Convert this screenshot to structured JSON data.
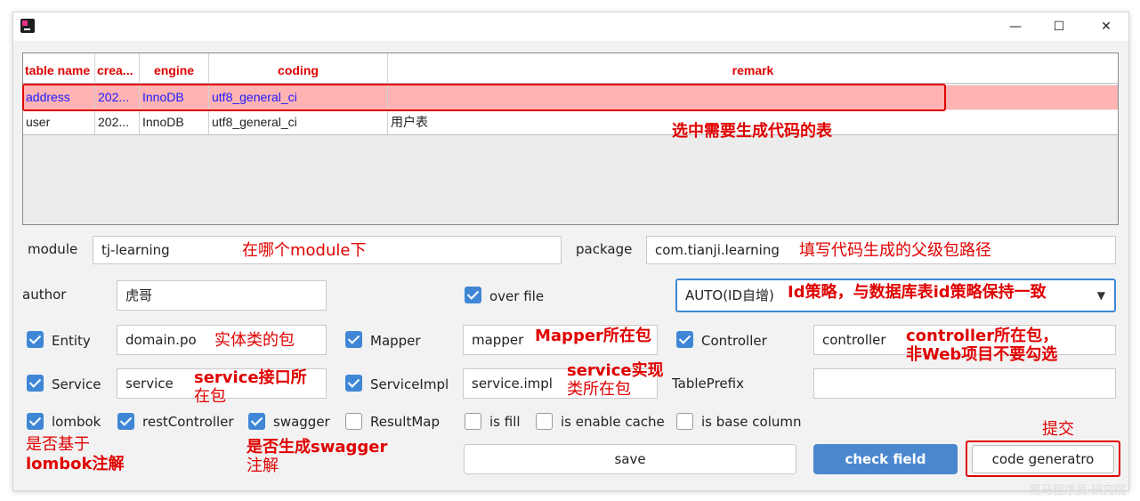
{
  "window": {
    "minimize": "—",
    "maximize": "☐",
    "close": "✕"
  },
  "table": {
    "headers": [
      "table name",
      "crea...",
      "engine",
      "coding",
      "remark"
    ],
    "rows": [
      [
        "address",
        "202...",
        "InnoDB",
        "utf8_general_ci",
        ""
      ],
      [
        "user",
        "202...",
        "InnoDB",
        "utf8_general_ci",
        "用户表"
      ]
    ]
  },
  "form": {
    "module_label": "module",
    "module_value": "tj-learning",
    "package_label": "package",
    "package_value": "com.tianji.learning",
    "author_label": "author",
    "author_value": "虎哥",
    "overfile_label": "over file",
    "idtype_value": "AUTO(ID自增)",
    "entity_label": "Entity",
    "entity_value": "domain.po",
    "mapper_label": "Mapper",
    "mapper_value": "mapper",
    "controller_label": "Controller",
    "controller_value": "controller",
    "service_label": "Service",
    "service_value": "service",
    "serviceimpl_label": "ServiceImpl",
    "serviceimpl_value": "service.impl",
    "tableprefix_label": "TablePrefix",
    "tableprefix_value": "",
    "lombok_label": "lombok",
    "restcontroller_label": "restController",
    "swagger_label": "swagger",
    "resultmap_label": "ResultMap",
    "isfill_label": "is fill",
    "cache_label": "is enable cache",
    "basecolumn_label": "is base column"
  },
  "buttons": {
    "save": "save",
    "check": "check field",
    "generate": "code generatro"
  },
  "annotations": {
    "select_table": "选中需要生成代码的表",
    "module_hint": "在哪个module下",
    "package_hint": "填写代码生成的父级包路径",
    "id_hint": "Id策略，与数据库表id策略保持一致",
    "entity_hint": "实体类的包",
    "mapper_hint": "Mapper所在包",
    "controller_hint_1": "controller所在包，",
    "controller_hint_2": "非Web项目不要勾选",
    "service_hint_1": "service接口所",
    "service_hint_2": "在包",
    "serviceimpl_hint_1": "service实现",
    "serviceimpl_hint_2": "类所在包",
    "lombok_hint_1": "是否基于",
    "lombok_hint_2": "lombok注解",
    "swagger_hint_1": "是否生成swagger",
    "swagger_hint_2": "注解",
    "submit_hint": "提交"
  },
  "watermark": "黑马程序员·研究院",
  "colors": {
    "accent": "#3f87d6",
    "annotation": "#e00000",
    "selected_row": "#ffb3b3",
    "selected_text": "#1a1aff"
  }
}
